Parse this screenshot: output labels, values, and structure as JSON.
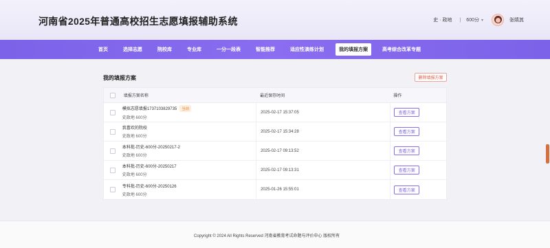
{
  "header": {
    "title": "河南省2025年普通高校招生志愿填报辅助系统",
    "profile_label": "史 · 政地",
    "separator": "|",
    "score_label": "600分",
    "username": "张婧其"
  },
  "nav": {
    "items": [
      {
        "label": "首页"
      },
      {
        "label": "选择志愿"
      },
      {
        "label": "院校库"
      },
      {
        "label": "专业库"
      },
      {
        "label": "一分一段表"
      },
      {
        "label": "智能推荐"
      },
      {
        "label": "适应性演练计划"
      },
      {
        "label": "我的填报方案",
        "active": true
      },
      {
        "label": "高考综合改革专题"
      }
    ]
  },
  "main": {
    "title": "我的填报方案",
    "delete_button": "删除填报方案",
    "columns": {
      "name": "填报方案名称",
      "time": "最近保存时间",
      "op": "操作"
    },
    "rows": [
      {
        "name": "模拟志愿填报1737103829735",
        "tag": "当前",
        "sub": "史政地 600分",
        "time": "2025-02-17 15:37:05",
        "button": "查看方案"
      },
      {
        "name": "我喜欢的院校",
        "tag": "",
        "sub": "史政地 600分",
        "time": "2025-02-17 15:34:28",
        "button": "查看方案"
      },
      {
        "name": "本科批-历史-600分-20250217-2",
        "tag": "",
        "sub": "史政地 600分",
        "time": "2025-02-17 09:13:52",
        "button": "查看方案"
      },
      {
        "name": "本科批-历史-600分-20250217",
        "tag": "",
        "sub": "史政地 600分",
        "time": "2025-02-17 09:13:31",
        "button": "查看方案"
      },
      {
        "name": "专科批-历史-600分-20250126",
        "tag": "",
        "sub": "史政地 600分",
        "time": "2025-01-26 15:55:01",
        "button": "查看方案"
      }
    ]
  },
  "footer": {
    "text": "Copyright © 2024 All Rights Reserved 河南省教育考试命题与评价中心 版权所有"
  },
  "colors": {
    "nav": "#7b62e8",
    "accent": "#8a6df0",
    "danger": "#e25a46",
    "tag": "#e78b3a"
  },
  "icons": [
    "chevron-down-icon",
    "avatar"
  ]
}
